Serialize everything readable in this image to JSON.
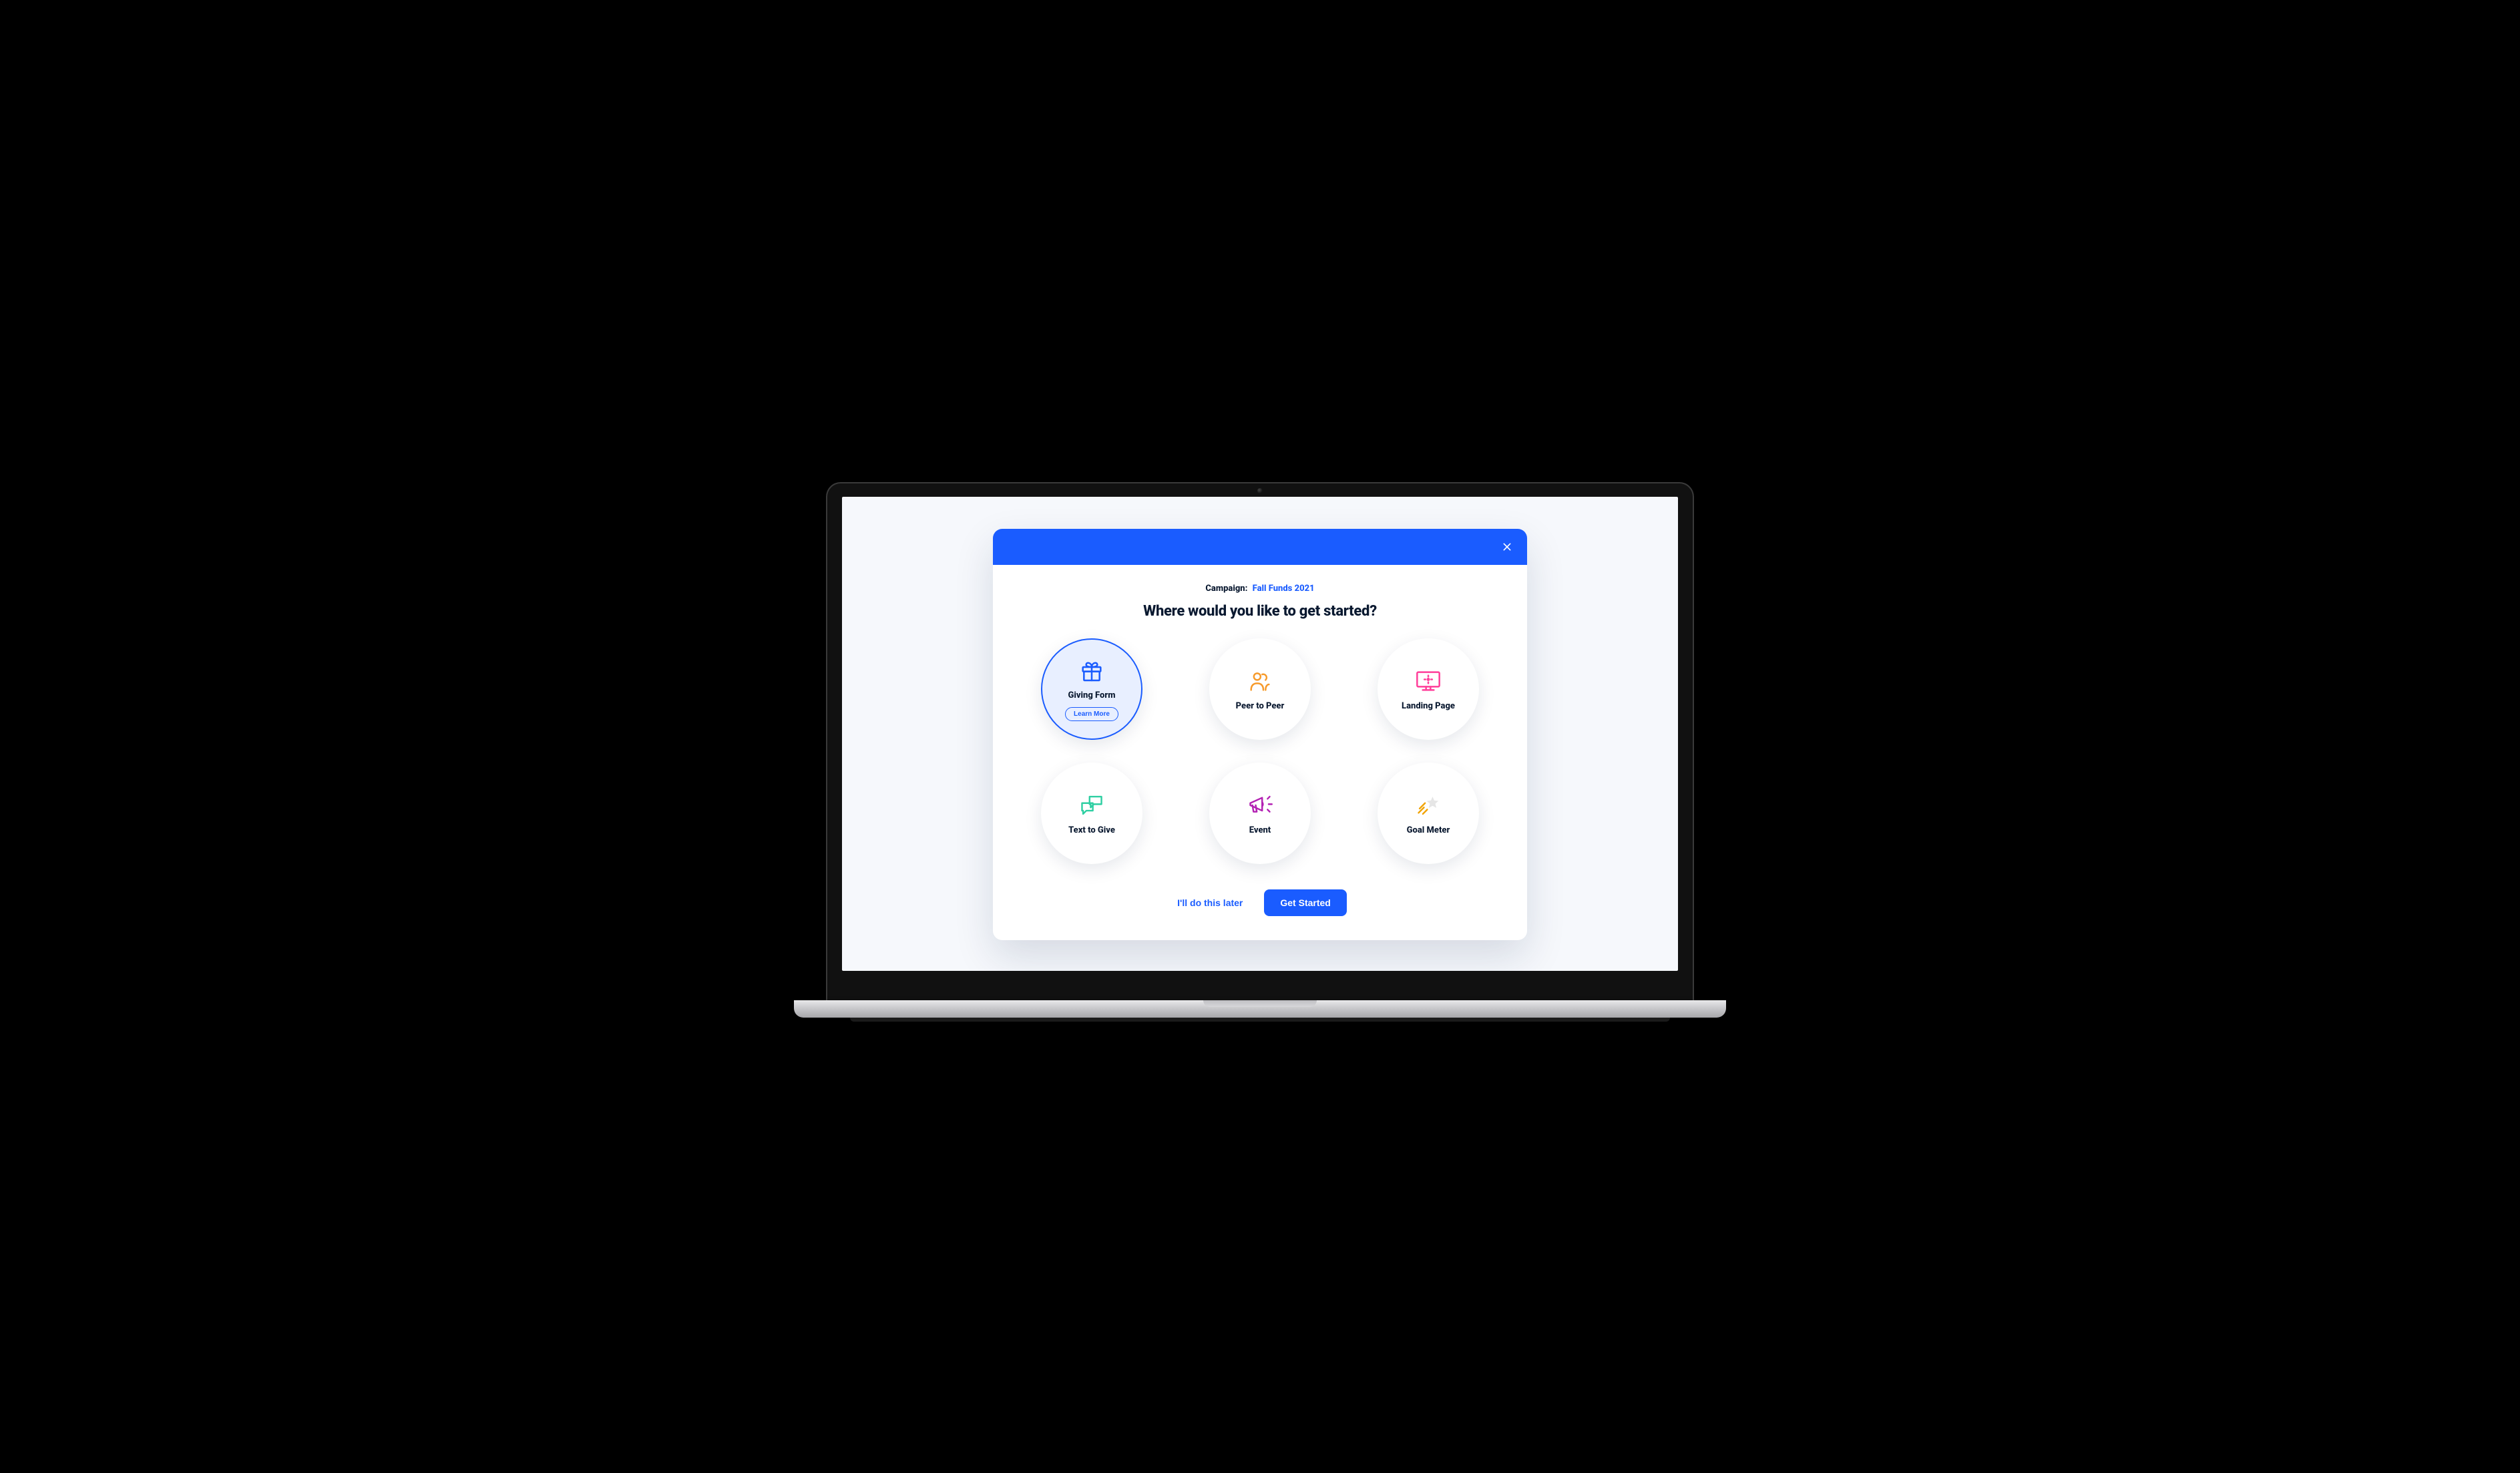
{
  "header": {
    "campaign_label": "Campaign:",
    "campaign_name": "Fall Funds 2021",
    "title": "Where would you like to get started?"
  },
  "options": [
    {
      "label": "Giving Form",
      "learn_more_label": "Learn More"
    },
    {
      "label": "Peer to Peer"
    },
    {
      "label": "Landing Page"
    },
    {
      "label": "Text to Give"
    },
    {
      "label": "Event"
    },
    {
      "label": "Goal Meter"
    }
  ],
  "actions": {
    "later_label": "I'll do this later",
    "primary_label": "Get Started"
  }
}
